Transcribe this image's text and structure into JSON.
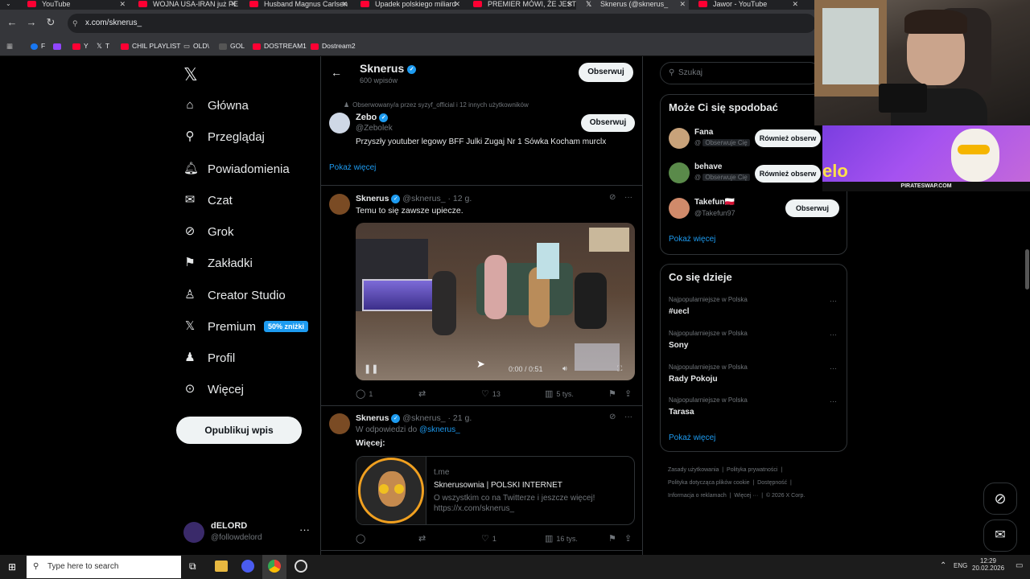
{
  "browser": {
    "tabs": [
      {
        "label": "YouTube",
        "icon": "youtube-icon"
      },
      {
        "label": "WOJNA USA-IRAN już PE",
        "icon": "youtube-icon"
      },
      {
        "label": "Husband Magnus Carlsen",
        "icon": "youtube-icon"
      },
      {
        "label": "Upadek polskiego miliard",
        "icon": "youtube-icon"
      },
      {
        "label": "PREMIER MÓWI, ŻE JEST",
        "icon": "youtube-icon"
      },
      {
        "label": "Sknerus (@sknerus_",
        "icon": "x-icon"
      },
      {
        "label": "Jawor - YouTube",
        "icon": "youtube-icon"
      }
    ],
    "url": "x.com/sknerus_",
    "bookmarks": [
      "F",
      "Y",
      "T",
      "CHIL PLAYLIST",
      "OLD\\",
      "GOL",
      "DOSTREAM1",
      "Dostream2"
    ]
  },
  "nav": {
    "items": [
      "Główna",
      "Przeglądaj",
      "Powiadomienia",
      "Czat",
      "Grok",
      "Zakładki",
      "Creator Studio",
      "Premium",
      "Profil",
      "Więcej"
    ],
    "premium_badge": "50% zniżki",
    "post_button": "Opublikuj wpis",
    "account_name": "dELORD",
    "account_handle": "@followdelord"
  },
  "header": {
    "name": "Sknerus",
    "posts": "600 wpisów",
    "follow": "Obserwuj"
  },
  "suggest": {
    "context": "Obserwowany/a przez syzyf_official i 12 innych użytkowników",
    "name": "Zebo",
    "handle": "@Zebolek",
    "bio": "Przyszły youtuber legowy BFF Julki Zugaj Nr 1 Sówka Kocham murclx",
    "follow": "Obserwuj",
    "show_more": "Pokaż więcej"
  },
  "post1": {
    "name": "Sknerus",
    "handle": "@sknerus_",
    "time": "· 12 g.",
    "text": "Temu to się zawsze upiecze.",
    "video_time": "0:00 / 0:51",
    "replies": "1",
    "likes": "13",
    "views": "5 tys."
  },
  "post2": {
    "name": "Sknerus",
    "handle": "@sknerus_",
    "time": "· 21 g.",
    "reply_prefix": "W odpowiedzi do",
    "reply_to": "@sknerus_",
    "text": "Więcej:",
    "card_domain": "t.me",
    "card_title": "Sknerusownia | POLSKI INTERNET",
    "card_desc": "O wszystkim co na Twitterze i jeszcze więcej!",
    "card_link": "https://x.com/sknerus_",
    "likes": "1",
    "views": "16 tys."
  },
  "right": {
    "search_placeholder": "Szukaj",
    "wtf_title": "Może Ci się spodobać",
    "follows_you": "Obserwuje Cię",
    "users": [
      {
        "name": "Fana",
        "handle": "@",
        "button": "Również obserw"
      },
      {
        "name": "behave",
        "handle": "@",
        "button": "Również obserw"
      },
      {
        "name": "Takefun🇵🇱",
        "handle": "@Takefun97",
        "button": "Obserwuj"
      }
    ],
    "show_more": "Pokaż więcej",
    "trends_title": "Co się dzieje",
    "trend_context": "Najpopularniejsze w Polska",
    "trends": [
      "#uecl",
      "Sony",
      "Rady Pokoju",
      "Tarasa"
    ],
    "footer": [
      "Zasady użytkowania",
      "Polityka prywatności",
      "Polityka dotycząca plików cookie",
      "Dostępność",
      "Informacja o reklamach",
      "Więcej ···",
      "© 2026 X Corp."
    ]
  },
  "overlay": {
    "banner": "PIRATESWAP.COM"
  },
  "taskbar": {
    "search": "Type here to search",
    "lang": "ENG",
    "time": "12:29",
    "date": "20.02.2026"
  },
  "colors": {
    "accent": "#1d9bf0",
    "background": "#000000",
    "border": "#2f3336",
    "muted": "#71767b"
  }
}
